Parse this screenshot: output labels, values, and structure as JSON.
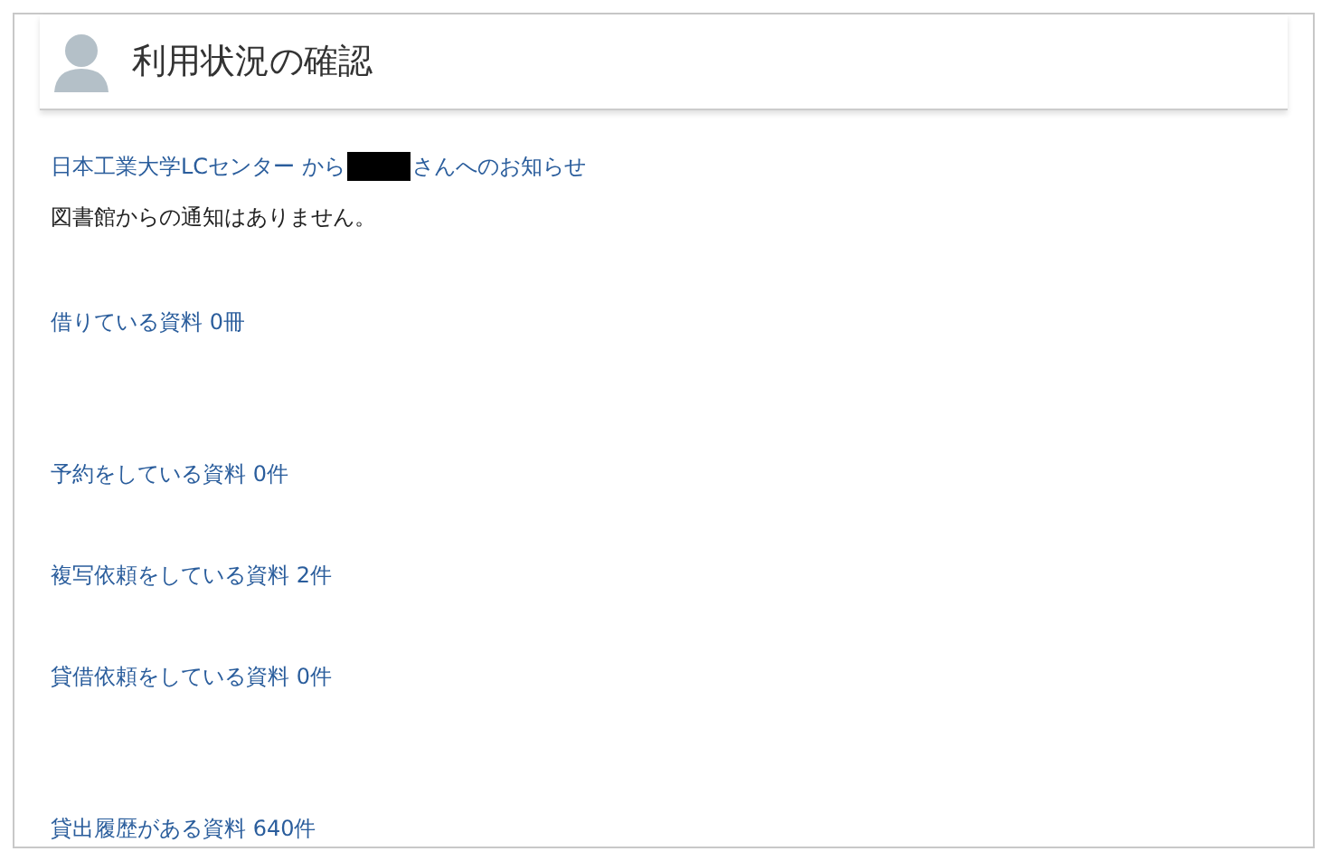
{
  "header": {
    "title": "利用状況の確認"
  },
  "notice": {
    "link_before": "日本工業大学LCセンター から",
    "link_after": "さんへのお知らせ",
    "message": "図書館からの通知はありません。"
  },
  "items": [
    {
      "label": "借りている資料 0冊"
    },
    {
      "label": "予約をしている資料 0件"
    },
    {
      "label": "複写依頼をしている資料 2件"
    },
    {
      "label": "貸借依頼をしている資料 0件"
    },
    {
      "label": "貸出履歴がある資料 640件"
    }
  ]
}
